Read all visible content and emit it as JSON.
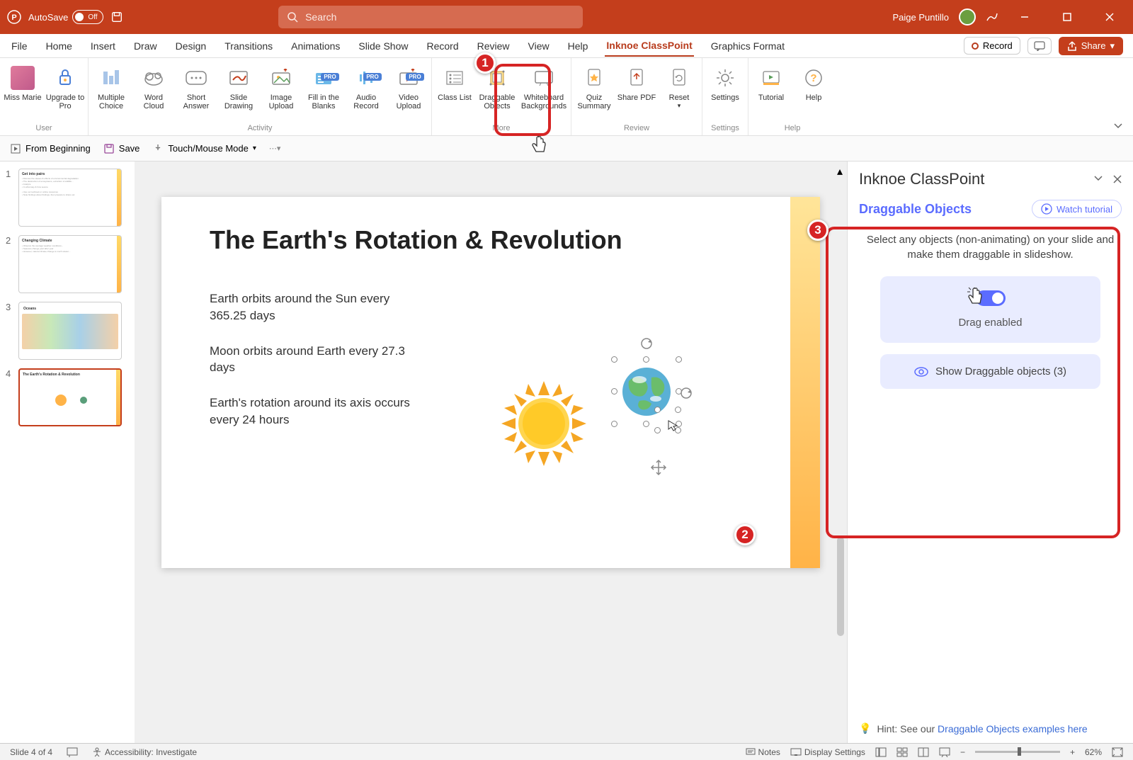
{
  "titlebar": {
    "autosave_label": "AutoSave",
    "autosave_state": "Off",
    "search_placeholder": "Search",
    "user_name": "Paige Puntillo"
  },
  "tabs": [
    "File",
    "Home",
    "Insert",
    "Draw",
    "Design",
    "Transitions",
    "Animations",
    "Slide Show",
    "Record",
    "Review",
    "View",
    "Help",
    "Inknoe ClassPoint",
    "Graphics Format"
  ],
  "active_tab": "Inknoe ClassPoint",
  "record_btn": "Record",
  "share_btn": "Share",
  "ribbon": {
    "groups": [
      {
        "label": "User",
        "items": [
          {
            "label": "Miss Marie"
          },
          {
            "label": "Upgrade to Pro"
          }
        ]
      },
      {
        "label": "Activity",
        "items": [
          {
            "label": "Multiple Choice"
          },
          {
            "label": "Word Cloud"
          },
          {
            "label": "Short Answer"
          },
          {
            "label": "Slide Drawing"
          },
          {
            "label": "Image Upload"
          },
          {
            "label": "Fill in the Blanks",
            "pro": true
          },
          {
            "label": "Audio Record",
            "pro": true
          },
          {
            "label": "Video Upload",
            "pro": true
          }
        ]
      },
      {
        "label": "More",
        "items": [
          {
            "label": "Class List"
          },
          {
            "label": "Draggable Objects"
          },
          {
            "label": "Whiteboard Backgrounds"
          }
        ]
      },
      {
        "label": "Review",
        "items": [
          {
            "label": "Quiz Summary"
          },
          {
            "label": "Share PDF"
          },
          {
            "label": "Reset"
          }
        ]
      },
      {
        "label": "Settings",
        "items": [
          {
            "label": "Settings"
          }
        ]
      },
      {
        "label": "Help",
        "items": [
          {
            "label": "Tutorial"
          },
          {
            "label": "Help"
          }
        ]
      }
    ]
  },
  "quickbar": {
    "from_beginning": "From Beginning",
    "save": "Save",
    "touch_mode": "Touch/Mouse Mode"
  },
  "thumbnails": [
    {
      "num": "1",
      "title": "Get into pairs"
    },
    {
      "num": "2",
      "title": "Changing Climate"
    },
    {
      "num": "3",
      "title": "Oceans"
    },
    {
      "num": "4",
      "title": "The Earth's Rotation & Revolution",
      "active": true
    }
  ],
  "slide": {
    "title": "The Earth's Rotation & Revolution",
    "p1": "Earth orbits around the Sun every 365.25 days",
    "p2": "Moon orbits around Earth every 27.3 days",
    "p3": "Earth's rotation around its axis occurs every 24 hours"
  },
  "sidepanel": {
    "title": "Inknoe ClassPoint",
    "section_title": "Draggable Objects",
    "watch_tutorial": "Watch tutorial",
    "desc": "Select any objects (non-animating) on your slide and make them draggable in slideshow.",
    "drag_enabled": "Drag enabled",
    "show_draggable": "Show Draggable objects (3)",
    "hint_prefix": "Hint: See our ",
    "hint_link": "Draggable Objects examples here"
  },
  "statusbar": {
    "slide_info": "Slide 4 of 4",
    "accessibility": "Accessibility: Investigate",
    "notes": "Notes",
    "display_settings": "Display Settings",
    "zoom": "62%"
  },
  "callouts": {
    "c1": "1",
    "c2": "2",
    "c3": "3"
  }
}
